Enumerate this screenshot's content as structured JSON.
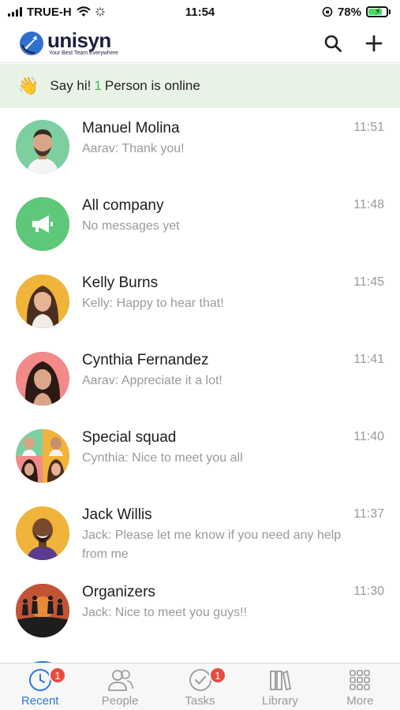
{
  "status_bar": {
    "carrier": "TRUE-H",
    "time": "11:54",
    "battery": "78%",
    "battery_level": 0.78
  },
  "header": {
    "app_name": "unisyn",
    "tagline": "Your Best Team Everywhere",
    "icons": [
      "search-icon",
      "plus-icon"
    ]
  },
  "banner": {
    "greeting": "Say hi!",
    "online_count": "1",
    "online_text": "Person is online",
    "icon": "waving-hand-icon"
  },
  "chats": [
    {
      "name": "Manuel Molina",
      "preview": "Aarav: Thank you!",
      "time": "11:51",
      "avatar_color": "#7dcfa0",
      "avatar_type": "person"
    },
    {
      "name": "All company",
      "preview": "No messages yet",
      "time": "11:48",
      "avatar_color": "#5fc779",
      "avatar_type": "megaphone"
    },
    {
      "name": "Kelly Burns",
      "preview": "Kelly: Happy to hear that!",
      "time": "11:45",
      "avatar_color": "#f0b43a",
      "avatar_type": "person"
    },
    {
      "name": "Cynthia Fernandez",
      "preview": "Aarav: Appreciate it a lot!",
      "time": "11:41",
      "avatar_color": "#f28a8a",
      "avatar_type": "person"
    },
    {
      "name": "Special squad",
      "preview": "Cynthia: Nice to meet you all",
      "time": "11:40",
      "avatar_color": "#f3a6a6",
      "avatar_type": "group"
    },
    {
      "name": "Jack Willis",
      "preview": "Jack: Please let me know if you need any help from me",
      "time": "11:37",
      "avatar_color": "#f0b43a",
      "avatar_type": "person"
    },
    {
      "name": "Organizers",
      "preview": "Jack: Nice to meet you guys!!",
      "time": "11:30",
      "avatar_color": "#b9482e",
      "avatar_type": "silhouettes"
    }
  ],
  "tabs": [
    {
      "label": "Recent",
      "icon": "clock-icon",
      "badge": "1",
      "active": true
    },
    {
      "label": "People",
      "icon": "people-icon",
      "badge": "",
      "active": false
    },
    {
      "label": "Tasks",
      "icon": "check-circle-icon",
      "badge": "1",
      "active": false
    },
    {
      "label": "Library",
      "icon": "books-icon",
      "badge": "",
      "active": false
    },
    {
      "label": "More",
      "icon": "grid-icon",
      "badge": "",
      "active": false
    }
  ],
  "colors": {
    "accent": "#2f78d4",
    "online": "#3cb95a",
    "badge": "#e84b3c",
    "banner_bg": "#e8f3e6"
  }
}
